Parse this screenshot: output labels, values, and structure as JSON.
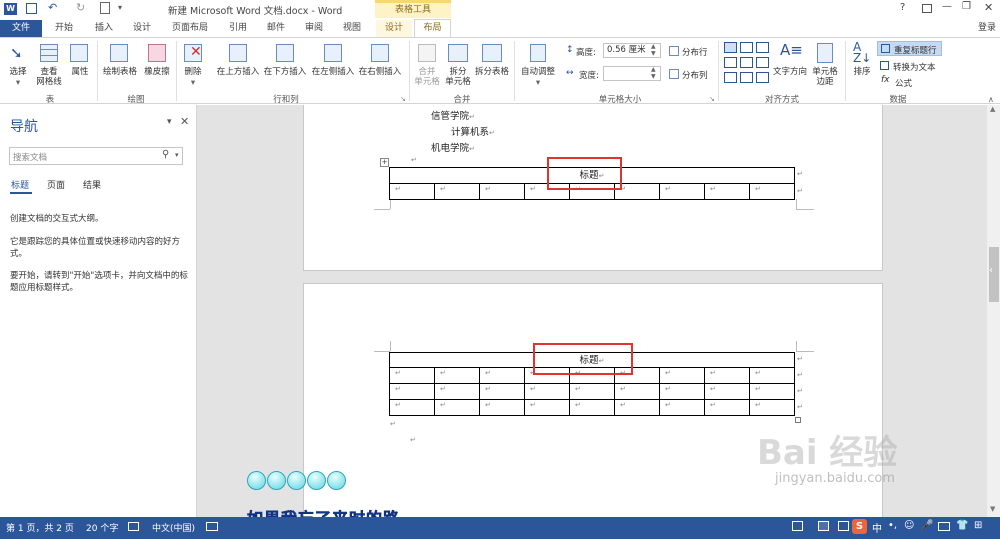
{
  "titlebar": {
    "title": "新建 Microsoft Word 文档.docx - Word",
    "context_group": "表格工具",
    "help": "?",
    "min": "—",
    "restore": "❐",
    "close": "✕"
  },
  "tabs": {
    "file": "文件",
    "home": "开始",
    "insert": "插入",
    "design": "设计",
    "pagelayout": "页面布局",
    "references": "引用",
    "mailings": "邮件",
    "review": "审阅",
    "view": "视图",
    "table_design": "设计",
    "table_layout": "布局",
    "login": "登录"
  },
  "ribbon": {
    "select": "选择",
    "view_gridlines_1": "查看",
    "view_gridlines_2": "网格线",
    "properties": "属性",
    "group_table": "表",
    "draw_table": "绘制表格",
    "eraser": "橡皮擦",
    "group_draw": "绘图",
    "delete": "删除",
    "insert_above": "在上方插入",
    "insert_below": "在下方插入",
    "insert_left": "在左侧插入",
    "insert_right": "在右侧插入",
    "group_rowscols": "行和列",
    "merge_1": "合并",
    "merge_2": "单元格",
    "split_1": "拆分",
    "split_2": "单元格",
    "split_table": "拆分表格",
    "group_merge": "合并",
    "autofit": "自动调整",
    "height_label": "高度:",
    "height_value": "0.56 厘米",
    "width_label": "宽度:",
    "width_value": "",
    "dist_rows": "分布行",
    "dist_cols": "分布列",
    "group_cellsize": "单元格大小",
    "text_direction": "文字方向",
    "cell_margins_1": "单元格",
    "cell_margins_2": "边距",
    "group_alignment": "对齐方式",
    "sort": "排序",
    "repeat_header": "重复标题行",
    "convert_text": "转换为文本",
    "formula": "公式",
    "group_data": "数据"
  },
  "nav": {
    "title": "导航",
    "search_placeholder": "搜索文档",
    "tab_headings": "标题",
    "tab_pages": "页面",
    "tab_results": "结果",
    "line1": "创建文档的交互式大纲。",
    "line2": "它是跟踪您的具体位置或快速移动内容的好方式。",
    "line3": "要开始，请转到\"开始\"选项卡，并向文档中的标题应用标题样式。"
  },
  "document": {
    "line_xinguan": "信管学院",
    "line_jisuanji": "计算机系",
    "line_jidian": "机电学院",
    "table_title_1": "标题",
    "table_title_2": "标题"
  },
  "overlay": {
    "subtitle": "如果我忘了来时的路"
  },
  "watermark": {
    "brand": "Bai 经验",
    "url": "jingyan.baidu.com"
  },
  "status": {
    "page": "第 1 页，共 2 页",
    "words": "20 个字",
    "language": "中文(中国)",
    "ime": "中"
  },
  "colors": {
    "accent": "#2b579a",
    "context_tab": "#f5d872",
    "highlight": "#e0342e"
  }
}
